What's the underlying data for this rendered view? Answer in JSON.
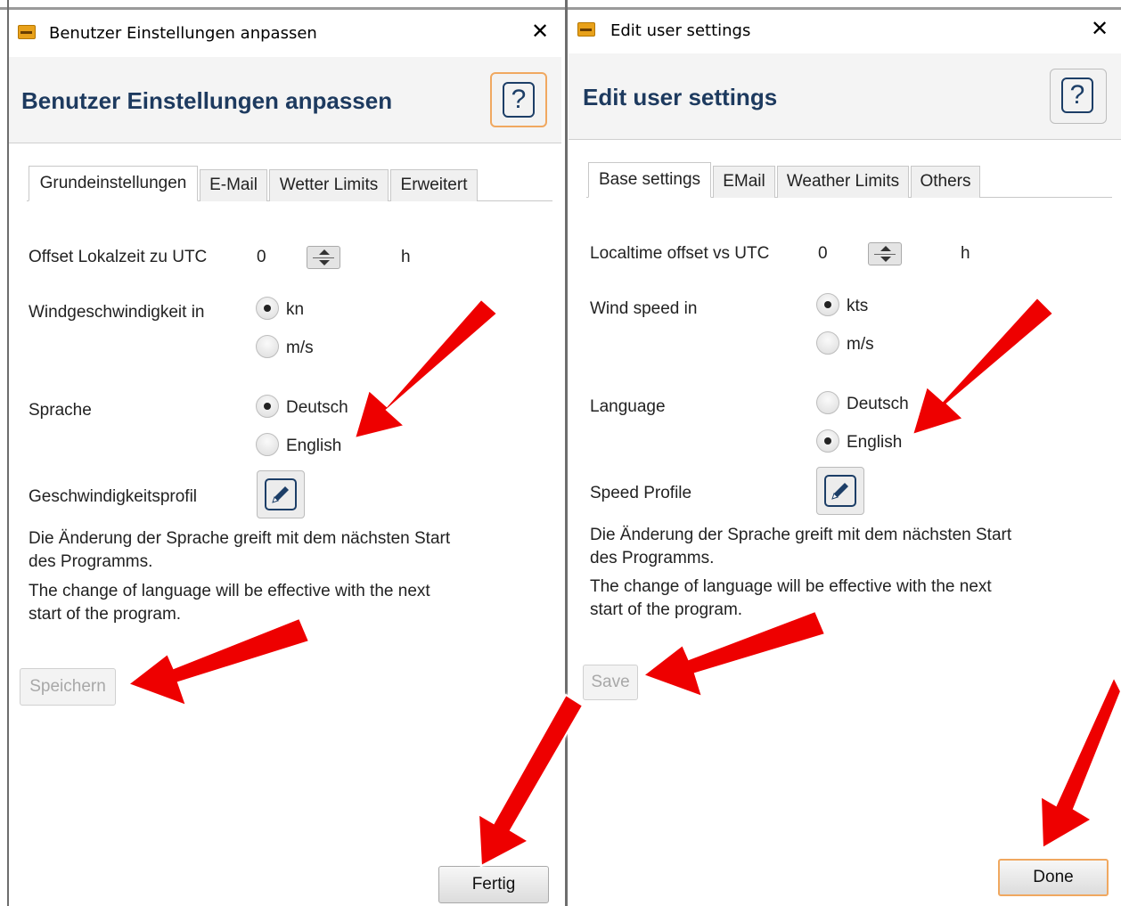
{
  "left": {
    "window_title": "Benutzer Einstellungen anpassen",
    "heading": "Benutzer Einstellungen anpassen",
    "help_symbol": "?",
    "close_symbol": "✕",
    "tabs": [
      "Grundeinstellungen",
      "E-Mail",
      "Wetter Limits",
      "Erweitert"
    ],
    "offset_label": "Offset Lokalzeit zu UTC",
    "offset_value": "0",
    "offset_unit": "h",
    "wind_label": "Windgeschwindigkeit in",
    "wind_options": [
      "kn",
      "m/s"
    ],
    "wind_selected": "kn",
    "language_label": "Sprache",
    "language_options": [
      "Deutsch",
      "English"
    ],
    "language_selected": "Deutsch",
    "speed_profile_label": "Geschwindigkeitsprofil",
    "note_de": "Die Änderung der Sprache greift mit dem nächsten Start des Programms.",
    "note_en": "The change of language will be effective with the next start of the program.",
    "save_label": "Speichern",
    "done_label": "Fertig"
  },
  "right": {
    "window_title": "Edit user settings",
    "heading": "Edit user settings",
    "help_symbol": "?",
    "close_symbol": "✕",
    "tabs": [
      "Base settings",
      "EMail",
      "Weather Limits",
      "Others"
    ],
    "offset_label": "Localtime offset vs UTC",
    "offset_value": "0",
    "offset_unit": "h",
    "wind_label": "Wind speed in",
    "wind_options": [
      "kts",
      "m/s"
    ],
    "wind_selected": "kts",
    "language_label": "Language",
    "language_options": [
      "Deutsch",
      "English"
    ],
    "language_selected": "English",
    "speed_profile_label": "Speed Profile",
    "note_de": "Die Änderung der Sprache greift mit dem nächsten Start des Programms.",
    "note_en": "The change of language will be effective with the next start of the program.",
    "save_label": "Save",
    "done_label": "Done"
  },
  "colors": {
    "heading": "#1d3a5f",
    "annotation_arrow": "#ee0000",
    "focus_outline": "#f0a860",
    "disabled_text": "#a8a8a8"
  },
  "icons": {
    "app": "app-logo-icon",
    "close": "close-icon",
    "help": "help-question-icon",
    "edit": "pencil-icon",
    "spinner": "spinner-arrows-icon",
    "annotation": "red-arrow-icon"
  }
}
